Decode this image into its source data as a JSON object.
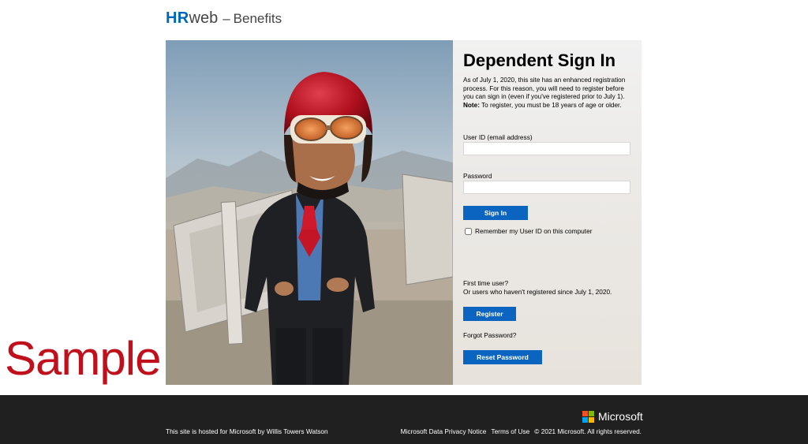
{
  "header": {
    "brand_hr": "HR",
    "brand_web": "web",
    "dash": "–",
    "subtitle": "Benefits",
    "accent_color": "#0067b8"
  },
  "hero": {
    "image_alt": "Child in a red helmet, goggles, suit and cardboard wings"
  },
  "signin": {
    "title": "Dependent Sign In",
    "desc_main": "As of July 1, 2020, this site has an enhanced registration process. For this reason, you will need to register before you can sign in (even if you've registered prior to July 1).",
    "note_label": "Note:",
    "note_text": "To register, you must be 18 years of age or older.",
    "userid_label": "User ID (email address)",
    "userid_value": "",
    "password_label": "Password",
    "password_value": "",
    "signin_button": "Sign In",
    "remember_label": "Remember my User ID on this computer",
    "remember_checked": false,
    "first_time_line1": "First time user?",
    "first_time_line2": "Or users who haven't registered since July 1, 2020.",
    "register_button": "Register",
    "forgot_label": "Forgot Password?",
    "reset_button": "Reset Password",
    "button_color": "#0b64c0"
  },
  "watermark": {
    "text": "Sample",
    "color": "#c0101c"
  },
  "footer": {
    "ms_logo_word": "Microsoft",
    "ms_logo_colors": [
      "#f25022",
      "#7fba00",
      "#00a4ef",
      "#ffb900"
    ],
    "hosted_text": "This site is hosted for Microsoft by Willis Towers Watson",
    "privacy_link": "Microsoft Data Privacy Notice",
    "terms_link": "Terms of Use",
    "copyright": "© 2021 Microsoft. All rights reserved.",
    "background": "#202020"
  }
}
